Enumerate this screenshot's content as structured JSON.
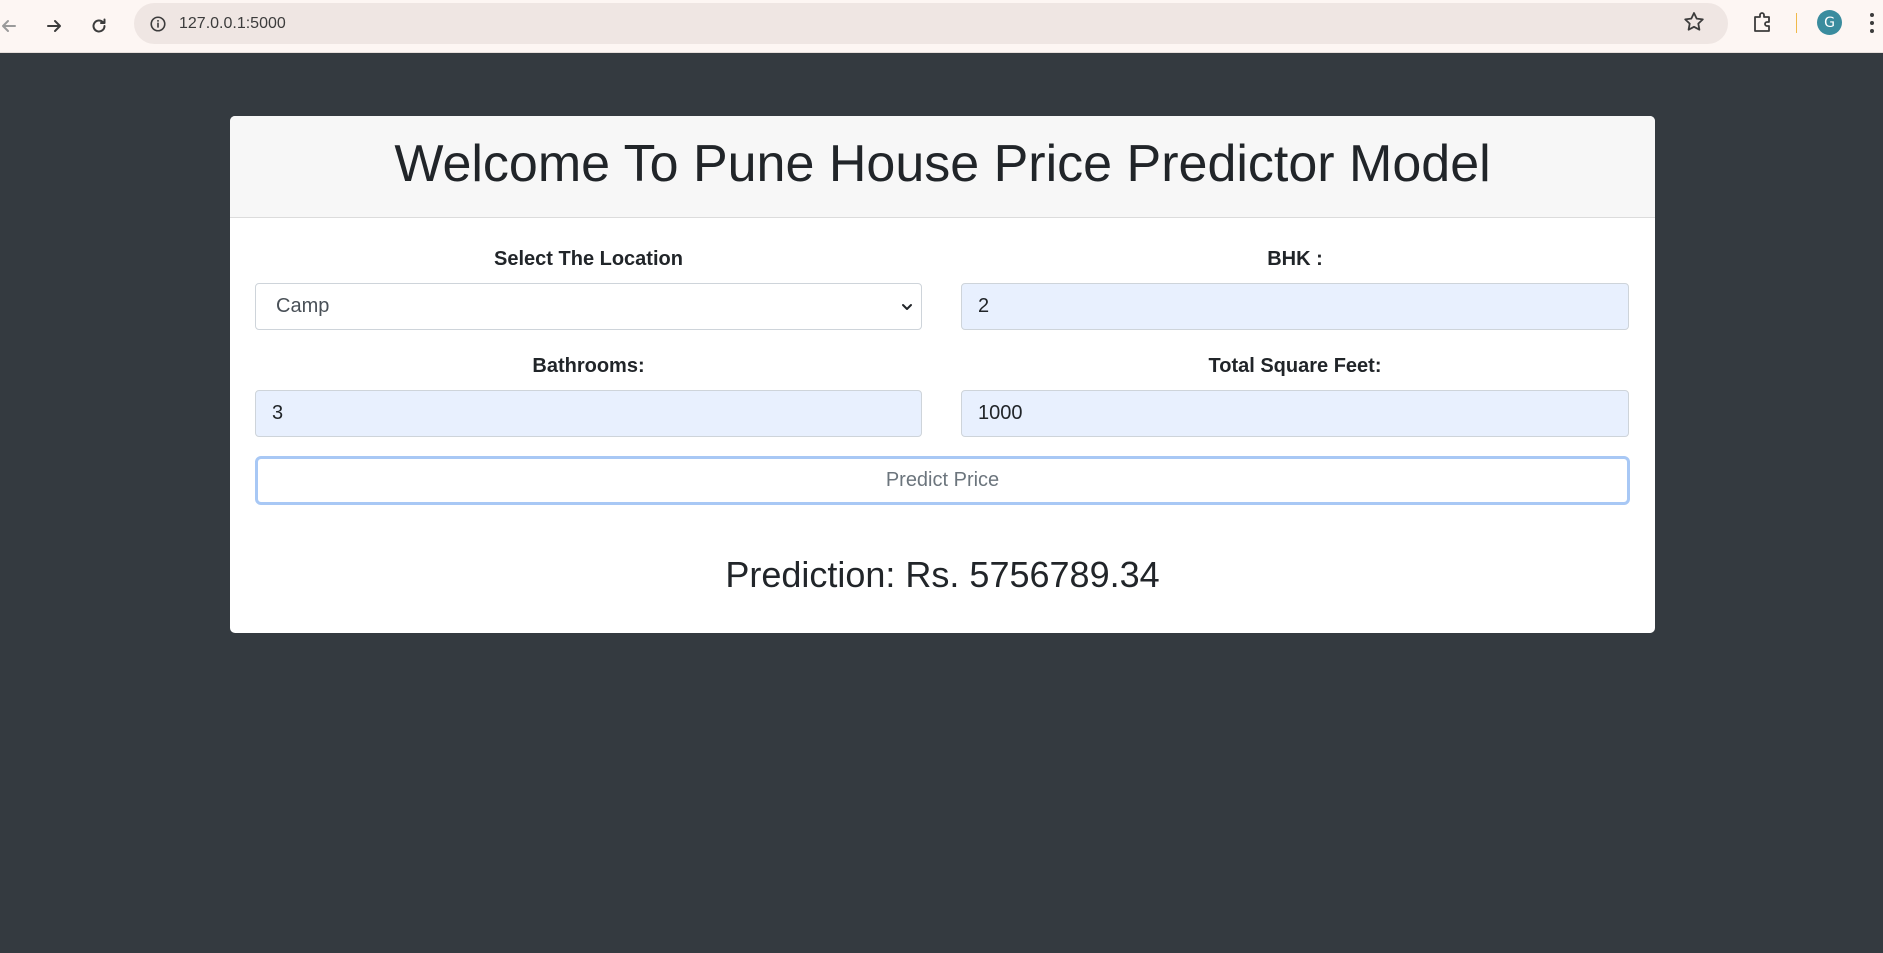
{
  "browser": {
    "url": "127.0.0.1:5000",
    "avatar_letter": "G",
    "icons": [
      "back-arrow-icon",
      "forward-arrow-icon",
      "reload-icon",
      "site-info-icon",
      "bookmark-star-icon",
      "extensions-icon",
      "more-menu-icon"
    ]
  },
  "card": {
    "title": "Welcome To Pune House Price Predictor Model",
    "location": {
      "label": "Select The Location",
      "value": "Camp"
    },
    "bhk": {
      "label": "BHK :",
      "value": "2"
    },
    "bathrooms": {
      "label": "Bathrooms:",
      "value": "3"
    },
    "sqft": {
      "label": "Total Square Feet:",
      "value": "1000"
    },
    "predict_button": "Predict Price",
    "prediction": "Prediction: Rs. 5756789.34"
  },
  "colors": {
    "page_background": "#343a40",
    "card_header": "#f7f7f7",
    "input_autofill": "#e8f0fe",
    "button_focus_ring": "#a8c8f5"
  }
}
